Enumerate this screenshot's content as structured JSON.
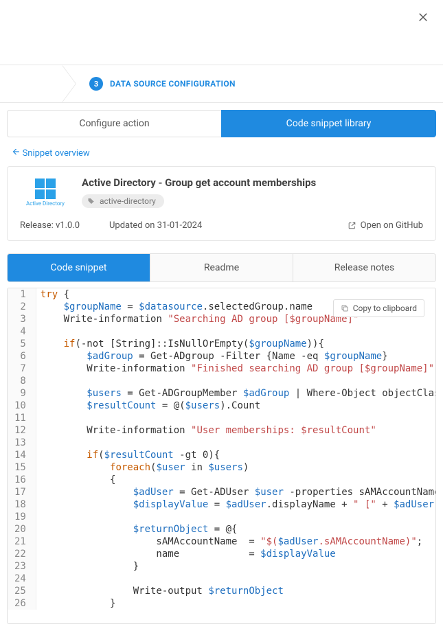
{
  "wizard": {
    "step_num": "3",
    "step_label": "DATA SOURCE CONFIGURATION"
  },
  "tabs": {
    "configure": "Configure action",
    "library": "Code snippet library"
  },
  "back_link": "Snippet overview",
  "snippet": {
    "title": "Active Directory - Group get account memberships",
    "logo_text": "Active Directory",
    "tag": "active-directory",
    "release": "Release: v1.0.0",
    "updated": "Updated on 31-01-2024",
    "github": "Open on GitHub"
  },
  "inner_tabs": {
    "code": "Code snippet",
    "readme": "Readme",
    "releasenotes": "Release notes"
  },
  "copy": "Copy to clipboard",
  "code_lines": [
    [
      [
        "kw",
        "try"
      ],
      [
        "pl",
        " {"
      ]
    ],
    [
      [
        "pl",
        "    "
      ],
      [
        "var",
        "$groupName"
      ],
      [
        "pl",
        " = "
      ],
      [
        "var",
        "$datasource"
      ],
      [
        "pl",
        ".selectedGroup.name"
      ]
    ],
    [
      [
        "pl",
        "    "
      ],
      [
        "fn",
        "Write-information"
      ],
      [
        "pl",
        " "
      ],
      [
        "str",
        "\"Searching AD group [$groupName]\""
      ]
    ],
    [],
    [
      [
        "pl",
        "    "
      ],
      [
        "kw",
        "if"
      ],
      [
        "pl",
        "(-not ["
      ],
      [
        "fn",
        "String"
      ],
      [
        "pl",
        "]::IsNullOrEmpty("
      ],
      [
        "var",
        "$groupName"
      ],
      [
        "pl",
        ")){"
      ]
    ],
    [
      [
        "pl",
        "        "
      ],
      [
        "var",
        "$adGroup"
      ],
      [
        "pl",
        " = "
      ],
      [
        "fn",
        "Get-ADgroup"
      ],
      [
        "pl",
        " -Filter {Name -eq "
      ],
      [
        "var",
        "$groupName"
      ],
      [
        "pl",
        "}"
      ]
    ],
    [
      [
        "pl",
        "        "
      ],
      [
        "fn",
        "Write-information"
      ],
      [
        "pl",
        " "
      ],
      [
        "str",
        "\"Finished searching AD group [$groupName]\""
      ]
    ],
    [],
    [
      [
        "pl",
        "        "
      ],
      [
        "var",
        "$users"
      ],
      [
        "pl",
        " = "
      ],
      [
        "fn",
        "Get-ADGroupMember"
      ],
      [
        "pl",
        " "
      ],
      [
        "var",
        "$adGroup"
      ],
      [
        "pl",
        " | "
      ],
      [
        "fn",
        "Where-Object"
      ],
      [
        "pl",
        " objectClass -eq"
      ]
    ],
    [
      [
        "pl",
        "        "
      ],
      [
        "var",
        "$resultCount"
      ],
      [
        "pl",
        " = @("
      ],
      [
        "var",
        "$users"
      ],
      [
        "pl",
        ").Count"
      ]
    ],
    [],
    [
      [
        "pl",
        "        "
      ],
      [
        "fn",
        "Write-information"
      ],
      [
        "pl",
        " "
      ],
      [
        "str",
        "\"User memberships: $resultCount\""
      ]
    ],
    [],
    [
      [
        "pl",
        "        "
      ],
      [
        "kw",
        "if"
      ],
      [
        "pl",
        "("
      ],
      [
        "var",
        "$resultCount"
      ],
      [
        "pl",
        " -gt "
      ],
      [
        "pl",
        "0"
      ],
      [
        "pl",
        "){"
      ]
    ],
    [
      [
        "pl",
        "            "
      ],
      [
        "kw",
        "foreach"
      ],
      [
        "pl",
        "("
      ],
      [
        "var",
        "$user"
      ],
      [
        "pl",
        " in "
      ],
      [
        "var",
        "$users"
      ],
      [
        "pl",
        ")"
      ]
    ],
    [
      [
        "pl",
        "            {"
      ]
    ],
    [
      [
        "pl",
        "                "
      ],
      [
        "var",
        "$adUser"
      ],
      [
        "pl",
        " = "
      ],
      [
        "fn",
        "Get-ADUser"
      ],
      [
        "pl",
        " "
      ],
      [
        "var",
        "$user"
      ],
      [
        "pl",
        " -properties sAMAccountName, dis"
      ]
    ],
    [
      [
        "pl",
        "                "
      ],
      [
        "var",
        "$displayValue"
      ],
      [
        "pl",
        " = "
      ],
      [
        "var",
        "$adUser"
      ],
      [
        "pl",
        ".displayName + "
      ],
      [
        "str",
        "\" [\""
      ],
      [
        "pl",
        " + "
      ],
      [
        "var",
        "$adUser"
      ],
      [
        "pl",
        ".sAMAc"
      ]
    ],
    [],
    [
      [
        "pl",
        "                "
      ],
      [
        "var",
        "$returnObject"
      ],
      [
        "pl",
        " = @{"
      ]
    ],
    [
      [
        "pl",
        "                    sAMAccountName  = "
      ],
      [
        "str",
        "\"$("
      ],
      [
        "var",
        "$adUser"
      ],
      [
        "str",
        ".sAMAccountName)\""
      ],
      [
        "pl",
        ";"
      ]
    ],
    [
      [
        "pl",
        "                    name            = "
      ],
      [
        "var",
        "$displayValue"
      ]
    ],
    [
      [
        "pl",
        "                }"
      ]
    ],
    [],
    [
      [
        "pl",
        "                "
      ],
      [
        "fn",
        "Write-output"
      ],
      [
        "pl",
        " "
      ],
      [
        "var",
        "$returnObject"
      ]
    ],
    [
      [
        "pl",
        "            }"
      ]
    ]
  ]
}
